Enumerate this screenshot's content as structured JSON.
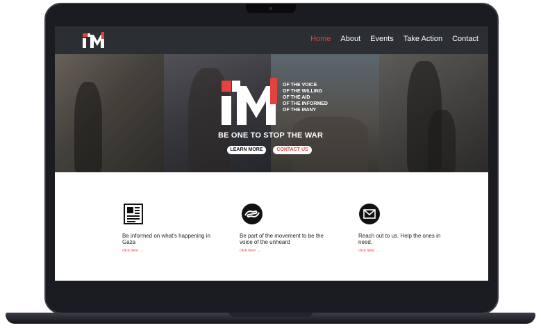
{
  "site": {
    "logo": "I.M",
    "nav": [
      {
        "label": "Home",
        "active": true
      },
      {
        "label": "About",
        "active": false
      },
      {
        "label": "Events",
        "active": false
      },
      {
        "label": "Take Action",
        "active": false
      },
      {
        "label": "Contact",
        "active": false
      }
    ]
  },
  "hero": {
    "logo": "I.M",
    "taglines": [
      "OF THE VOICE",
      "OF THE WILLING",
      "OF THE AID",
      "OF THE INFORMED",
      "OF THE MANY"
    ],
    "slogan": "BE ONE TO STOP THE WAR",
    "learn_more": "LEARN MORE",
    "contact_us": "CONTACT US"
  },
  "features": [
    {
      "icon": "newspaper-icon",
      "text": "Be informed on what's happening in Gaza",
      "link": "click here →"
    },
    {
      "icon": "helping-hands-icon",
      "text": "Be part of the movement to be the voice of the unheard",
      "link": "click here →"
    },
    {
      "icon": "envelope-icon",
      "text": "Reach out to us. Help the ones in need.",
      "link": "click here →"
    }
  ],
  "colors": {
    "accent": "#e3423f",
    "nav_bg": "#2b2e33",
    "laptop": "#1b1c22"
  }
}
